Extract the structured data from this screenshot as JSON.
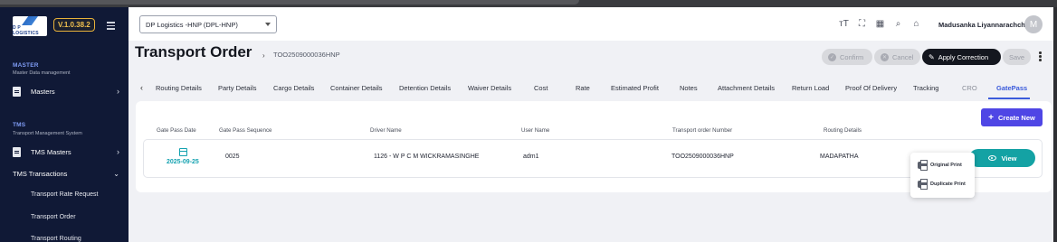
{
  "app": {
    "logo_text": "D P LOGISTICS",
    "version": "V.1.0.38.2"
  },
  "sidebar": {
    "master_title": "MASTER",
    "master_sub": "Master Data management",
    "masters_label": "Masters",
    "tms_title": "TMS",
    "tms_sub": "Transport Management System",
    "tms_masters_label": "TMS Masters",
    "tms_transactions_label": "TMS Transactions",
    "sub_items": [
      "Transport Rate Request",
      "Transport Order",
      "Transport Routing"
    ]
  },
  "header": {
    "company": "DP Logistics -HNP  (DPL-HNP)",
    "icons": [
      "text-size-icon",
      "fullscreen-icon",
      "apps-grid-icon",
      "search-icon",
      "home-icon"
    ],
    "user_name": "Madusanka Liyannarachchi",
    "avatar_initial": "M"
  },
  "page": {
    "title": "Transport Order",
    "breadcrumb_id": "TOO2509000036HNP"
  },
  "actions": {
    "confirm": "Confirm",
    "cancel": "Cancel",
    "apply_correction": "Apply Correction",
    "save": "Save"
  },
  "tabs": [
    "Routing Details",
    "Party Details",
    "Cargo Details",
    "Container Details",
    "Detention Details",
    "Waiver Details",
    "Cost",
    "Rate",
    "Estimated Profit",
    "Notes",
    "Attachment Details",
    "Return Load",
    "Proof Of Delivery",
    "Tracking",
    "CRO",
    "GatePass"
  ],
  "active_tab": "GatePass",
  "gatepass": {
    "create_button": "Create New",
    "columns": [
      "Gate Pass Date",
      "Gate Pass Sequence",
      "Driver Name",
      "User Name",
      "Transport order Number",
      "Routing Details"
    ],
    "row": {
      "date": "2025-09-25",
      "sequence": "0025",
      "driver": "1126 - W P C M WICKRAMASINGHE",
      "user": "adm1",
      "order_number": "TOO2509000036HNP",
      "routing": "MADAPATHA"
    },
    "view_button": "View",
    "print_menu": [
      "Original Print",
      "Duplicate Print"
    ]
  },
  "colors": {
    "sidebar_bg": "#101936",
    "accent": "#3b5bdb",
    "create_button": "#4f46e5",
    "teal": "#14a2a4"
  }
}
